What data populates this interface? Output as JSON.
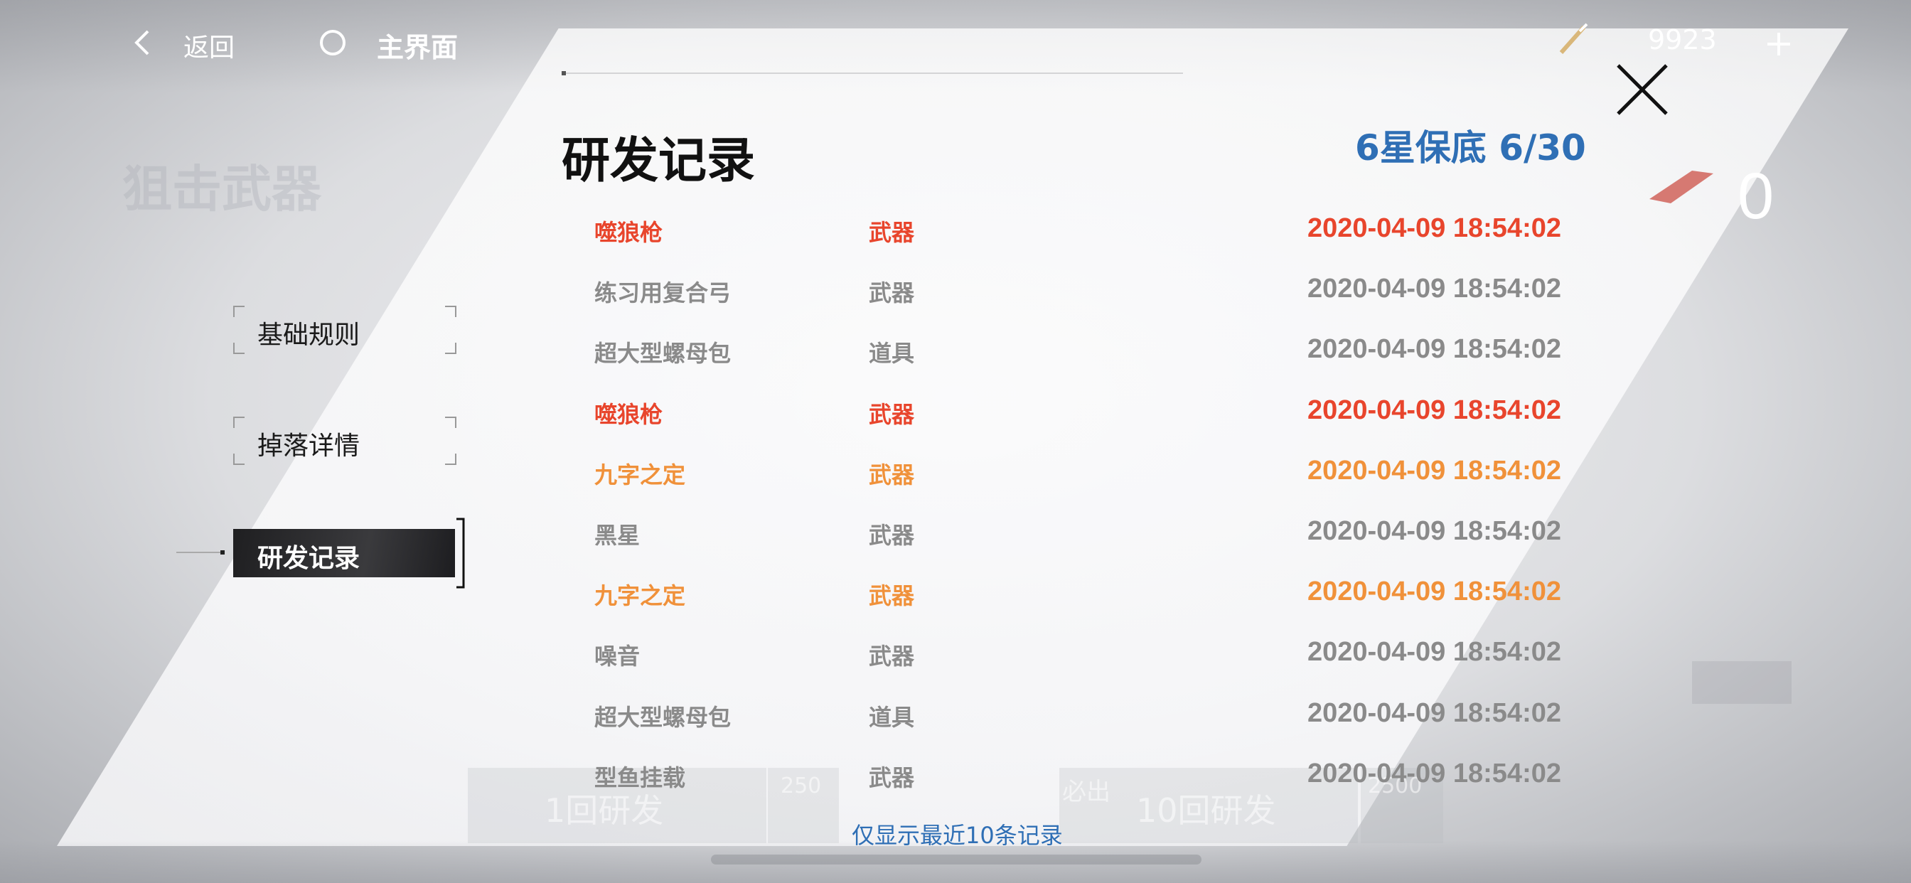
{
  "header": {
    "back_label": "返回",
    "home_label": "主界面",
    "currency_amount": "9923",
    "icons": [
      "chevron-left-icon",
      "home-circle-icon",
      "pen-currency-icon",
      "plus-icon",
      "close-icon"
    ]
  },
  "side_counter": "0",
  "nav": {
    "items": [
      {
        "label": "基础规则",
        "active": false
      },
      {
        "label": "掉落详情",
        "active": false
      },
      {
        "label": "研发记录",
        "active": true
      }
    ]
  },
  "panel": {
    "title": "研发记录",
    "pity_label": "6星保底 6/30",
    "footer_note": "仅显示最近10条记录",
    "records": [
      {
        "name": "噬狼枪",
        "type": "武器",
        "time": "2020-04-09 18:54:02",
        "color": "#e8452c"
      },
      {
        "name": "练习用复合弓",
        "type": "武器",
        "time": "2020-04-09 18:54:02",
        "color": "#8a8a8a"
      },
      {
        "name": "超大型螺母包",
        "type": "道具",
        "time": "2020-04-09 18:54:02",
        "color": "#8a8a8a"
      },
      {
        "name": "噬狼枪",
        "type": "武器",
        "time": "2020-04-09 18:54:02",
        "color": "#e8452c"
      },
      {
        "name": "九字之定",
        "type": "武器",
        "time": "2020-04-09 18:54:02",
        "color": "#f0913a"
      },
      {
        "name": "黑星",
        "type": "武器",
        "time": "2020-04-09 18:54:02",
        "color": "#8a8a8a"
      },
      {
        "name": "九字之定",
        "type": "武器",
        "time": "2020-04-09 18:54:02",
        "color": "#f0913a"
      },
      {
        "name": "噪音",
        "type": "武器",
        "time": "2020-04-09 18:54:02",
        "color": "#8a8a8a"
      },
      {
        "name": "超大型螺母包",
        "type": "道具",
        "time": "2020-04-09 18:54:02",
        "color": "#8a8a8a"
      },
      {
        "name": "型鱼挂载",
        "type": "武器",
        "time": "2020-04-09 18:54:02",
        "color": "#8a8a8a"
      }
    ]
  },
  "background": {
    "banner_title": "狙击武器",
    "btn_single": "1回研发",
    "btn_single_cost": "250",
    "btn_ten_tag": "必出",
    "btn_ten": "10回研发",
    "btn_ten_cost": "2500"
  },
  "colors": {
    "accent_blue": "#2f6fb5",
    "rare_red": "#e8452c",
    "rare_orange": "#f0913a",
    "common_gray": "#8a8a8a"
  }
}
